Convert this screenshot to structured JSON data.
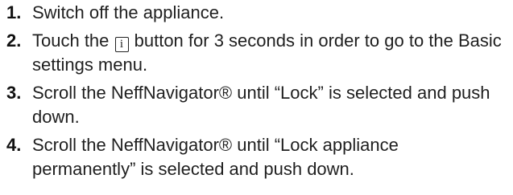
{
  "steps": [
    {
      "number": "1.",
      "text": "Switch off the appliance."
    },
    {
      "number": "2.",
      "text_before": "Touch the ",
      "icon": "info-key-icon",
      "icon_glyph": "i",
      "text_after": " button for 3 seconds in order to go to the Basic settings menu."
    },
    {
      "number": "3.",
      "text": "Scroll the NeffNavigator® until “Lock” is selected and push down."
    },
    {
      "number": "4.",
      "text": "Scroll the NeffNavigator® until “Lock appliance permanently” is selected and push down."
    }
  ]
}
